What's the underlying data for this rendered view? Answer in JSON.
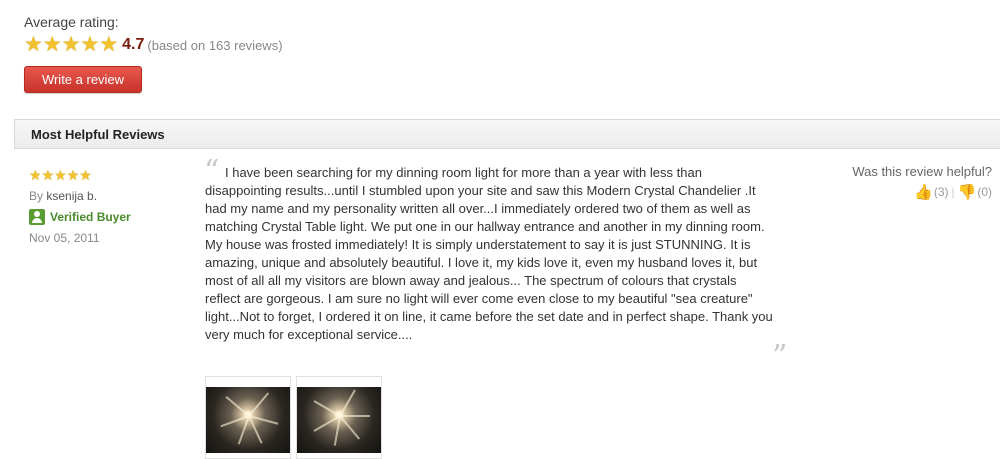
{
  "summary": {
    "average_label": "Average rating:",
    "rating_value": "4.7",
    "rating_stars": 5,
    "reviews_count_text": "(based on 163 reviews)",
    "write_review_label": "Write a review"
  },
  "section": {
    "title": "Most Helpful Reviews"
  },
  "review": {
    "stars": 5,
    "by_label": "By",
    "author": "ksenija b.",
    "verified_label": "Verified Buyer",
    "date": "Nov 05, 2011",
    "open_quote": "“",
    "close_quote": "”",
    "text": "I have been searching for my dinning room light for more than a year with less than disappointing results...until I stumbled upon your site and saw this Modern Crystal Chandelier .It had my name and my personality written all over...I immediately ordered two of them as well as matching Crystal Table light. We put one in our hallway entrance and another in my dinning room. My house was frosted immediately! It is simply understatement to say it is just STUNNING. It is amazing, unique and absolutely beautiful. I love it, my kids love it, even my husband loves it, but most of all all my visitors are blown away and jealous... The spectrum of colours that crystals reflect are gorgeous. I am sure no light will ever come even close to my beautiful \"sea creature\" light...Not to forget, I ordered it on line, it came before the set date and in perfect shape. Thank you very much for exceptional service....",
    "helpful_question": "Was this review helpful?",
    "helpful_yes": "(3)",
    "helpful_no": "(0)",
    "vote_separator": "|"
  },
  "colors": {
    "button": "#d9413a",
    "stars": "#f1c22e",
    "verified": "#4a8a2a",
    "rating_number": "#7a1a0a"
  },
  "icons": {
    "star": "star-icon",
    "verified": "verified-buyer-icon",
    "thumbs_up": "thumbs-up-icon",
    "thumbs_down": "thumbs-down-icon",
    "quote": "quote-mark-icon"
  }
}
